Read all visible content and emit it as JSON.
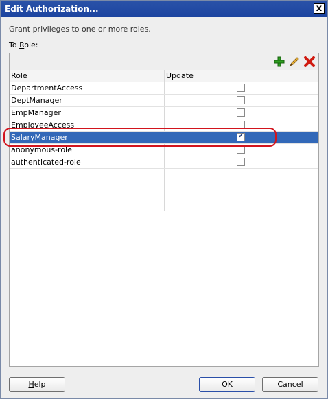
{
  "window": {
    "title": "Edit Authorization...",
    "close_label": "x"
  },
  "description": "Grant privileges to one or more roles.",
  "to_role": {
    "prefix": "To ",
    "mnemonic": "R",
    "suffix": "ole:"
  },
  "table": {
    "headers": {
      "role": "Role",
      "update": "Update"
    },
    "rows": [
      {
        "role": "DepartmentAccess",
        "update": false
      },
      {
        "role": "DeptManager",
        "update": false
      },
      {
        "role": "EmpManager",
        "update": false
      },
      {
        "role": "EmployeeAccess",
        "update": false
      },
      {
        "role": "SalaryManager",
        "update": true
      },
      {
        "role": "anonymous-role",
        "update": false
      },
      {
        "role": "authenticated-role",
        "update": false
      }
    ],
    "selected_row": "SalaryManager"
  },
  "toolbar": {
    "add_icon": "add-icon",
    "edit_icon": "pencil-icon",
    "delete_icon": "delete-x-icon"
  },
  "buttons": {
    "help": {
      "mnemonic": "H",
      "rest": "elp"
    },
    "ok": "OK",
    "cancel": "Cancel"
  },
  "colors": {
    "titlebar": "#1c44a0",
    "selection": "#3268b8",
    "highlight": "#d2141d"
  }
}
